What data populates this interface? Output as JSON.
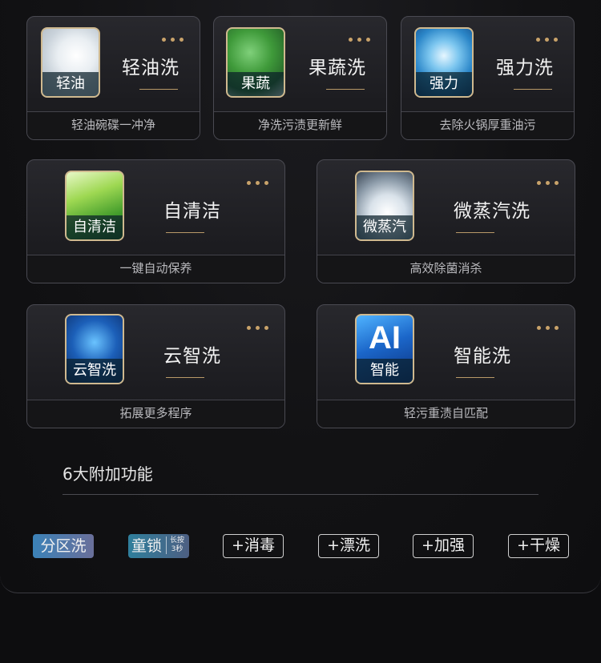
{
  "cards": [
    {
      "title": "轻油洗",
      "icon_label": "轻油",
      "subtitle": "轻油碗碟一冲净",
      "icon": "plate-icon"
    },
    {
      "title": "果蔬洗",
      "icon_label": "果蔬",
      "subtitle": "净洗污渍更新鲜",
      "icon": "vegetable-icon"
    },
    {
      "title": "强力洗",
      "icon_label": "强力",
      "subtitle": "去除火锅厚重油污",
      "icon": "water-swirl-icon"
    },
    {
      "title": "自清洁",
      "icon_label": "自清洁",
      "subtitle": "一键自动保养",
      "icon": "leaf-icon"
    },
    {
      "title": "微蒸汽洗",
      "icon_label": "微蒸汽",
      "subtitle": "高效除菌消杀",
      "icon": "steam-bowl-icon"
    },
    {
      "title": "云智洗",
      "icon_label": "云智洗",
      "subtitle": "拓展更多程序",
      "icon": "cloud-chip-icon"
    },
    {
      "title": "智能洗",
      "icon_label": "智能",
      "icon_text": "AI",
      "subtitle": "轻污重渍自匹配",
      "icon": "ai-icon"
    }
  ],
  "section": {
    "title": "6大附加功能"
  },
  "tags": [
    {
      "label": "分区洗"
    },
    {
      "label": "童锁",
      "note": "长按3秒"
    },
    {
      "label": "+消毒"
    },
    {
      "label": "+漂洗"
    },
    {
      "label": "+加强"
    },
    {
      "label": "+干燥"
    }
  ],
  "colors": {
    "accent": "#c9a36a",
    "background": "#121214",
    "card_border": "#4a4a52"
  }
}
